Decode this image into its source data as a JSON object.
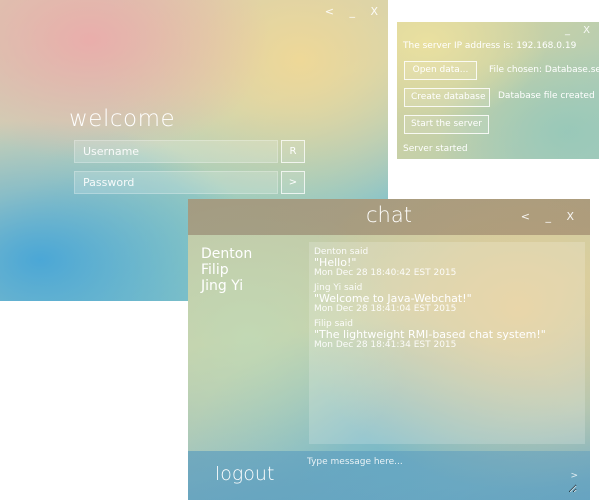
{
  "login": {
    "controls": {
      "back": "<",
      "minimize": "_",
      "close": "X"
    },
    "title": "welcome",
    "username_placeholder": "Username",
    "password_placeholder": "Password",
    "register_label": "R",
    "submit_label": ">"
  },
  "server": {
    "controls": {
      "minimize": "_",
      "close": "X"
    },
    "ip_text": "The server IP address is: 192.168.0.19",
    "open_button": "Open data...",
    "file_chosen_text": "File chosen: Database.ser",
    "create_button": "Create database",
    "created_text": "Database file created",
    "start_button": "Start the server",
    "started_text": "Server started"
  },
  "chat": {
    "controls": {
      "back": "<",
      "minimize": "_",
      "close": "X"
    },
    "title": "chat",
    "users": [
      "Denton",
      "Filip",
      "Jing Yi"
    ],
    "messages": [
      {
        "sender": "Denton said",
        "text": "\"Hello!\"",
        "time": "Mon Dec 28 18:40:42 EST 2015"
      },
      {
        "sender": "Jing Yi said",
        "text": "\"Welcome to Java-Webchat!\"",
        "time": "Mon Dec 28 18:41:04 EST 2015"
      },
      {
        "sender": "Filip said",
        "text": "\"The lightweight RMI-based chat system!\"",
        "time": "Mon Dec 28 18:41:34 EST 2015"
      }
    ],
    "logout_label": "logout",
    "input_placeholder": "Type message here...",
    "send_label": ">"
  }
}
